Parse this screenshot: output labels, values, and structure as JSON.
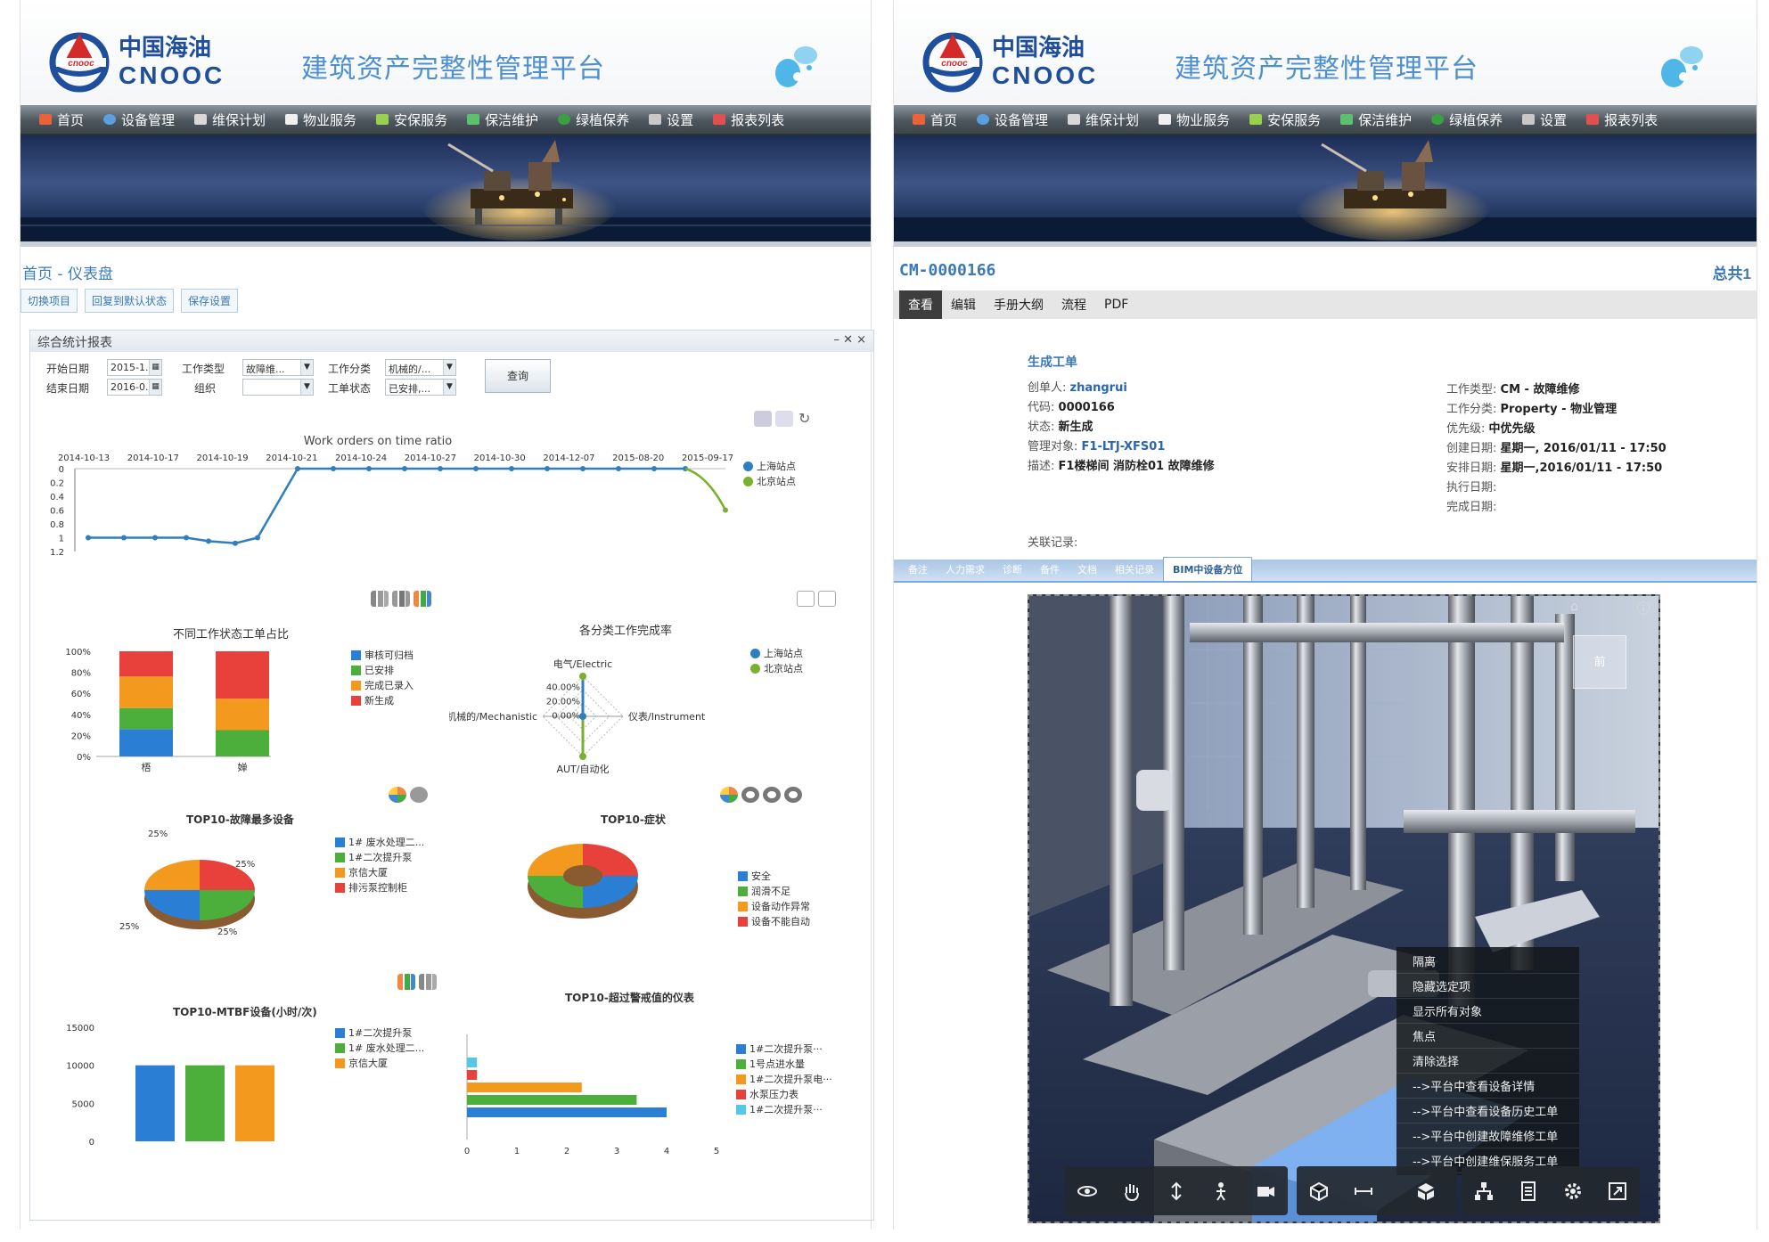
{
  "platform_title": "建筑资产完整性管理平台",
  "brand": {
    "cn": "中国海油",
    "en": "CNOOC",
    "mark": "CNOOC"
  },
  "nav": [
    {
      "label": "首页",
      "icon": "home-icon",
      "color": "#e8633a"
    },
    {
      "label": "设备管理",
      "icon": "equipment-icon",
      "color": "#5aa0e0"
    },
    {
      "label": "维保计划",
      "icon": "plan-icon",
      "color": "#d8d8d8"
    },
    {
      "label": "物业服务",
      "icon": "property-icon",
      "color": "#f0f0f0"
    },
    {
      "label": "安保服务",
      "icon": "security-icon",
      "color": "#9ad050"
    },
    {
      "label": "保洁维护",
      "icon": "clean-icon",
      "color": "#5cc070"
    },
    {
      "label": "绿植保养",
      "icon": "plant-icon",
      "color": "#3aa040"
    },
    {
      "label": "设置",
      "icon": "settings-icon",
      "color": "#c8c8c8"
    },
    {
      "label": "报表列表",
      "icon": "report-icon",
      "color": "#e05050"
    }
  ],
  "left": {
    "breadcrumb": "首页 - 仪表盘",
    "buttons": [
      "切换项目",
      "回复到默认状态",
      "保存设置"
    ],
    "report_title": "综合统计报表",
    "window_controls": "– ✕ ×",
    "filter": {
      "start_label": "开始日期",
      "start_value": "2015-1...",
      "end_label": "结束日期",
      "end_value": "2016-0...",
      "type_label": "工作类型",
      "type_value": "故障维...",
      "org_label": "组织",
      "org_value": "",
      "cat_label": "工作分类",
      "cat_value": "机械的/...",
      "status_label": "工单状态",
      "status_value": "已安排,...",
      "query": "查询"
    },
    "line_chart": {
      "title": "Work orders on time ratio",
      "dates": [
        "2014-10-13",
        "2014-10-17",
        "2014-10-19",
        "2014-10-21",
        "2014-10-24",
        "2014-10-27",
        "2014-10-30",
        "2014-12-07",
        "2015-08-20",
        "2015-09-17"
      ],
      "yticks": [
        "0",
        "0.2",
        "0.4",
        "0.6",
        "0.8",
        "1",
        "1.2"
      ],
      "legend": [
        {
          "name": "上海站点",
          "color": "#2f7fc0"
        },
        {
          "name": "北京站点",
          "color": "#7ab030"
        }
      ]
    },
    "status_chart": {
      "title": "不同工作状态工单占比",
      "yticks": [
        "100%",
        "80%",
        "60%",
        "40%",
        "20%",
        "0%"
      ],
      "cats": [
        "梧",
        "婵"
      ],
      "legend": [
        {
          "name": "审核可归档",
          "color": "#2a7fd4"
        },
        {
          "name": "已安排",
          "color": "#4caf3c"
        },
        {
          "name": "完成已录入",
          "color": "#f39a1e"
        },
        {
          "name": "新生成",
          "color": "#e8403a"
        }
      ]
    },
    "radar_chart": {
      "title": "各分类工作完成率",
      "axes": [
        "电气/Electric",
        "仪表/Instrument",
        "AUT/自动化",
        "机械的/Mechanistic"
      ],
      "ticks": [
        "40.00%",
        "20.00%",
        "0.00%"
      ],
      "legend": [
        {
          "name": "上海站点",
          "color": "#2f7fc0"
        },
        {
          "name": "北京站点",
          "color": "#7ab030"
        }
      ]
    },
    "pie_chart": {
      "title": "TOP10-故障最多设备",
      "labels": [
        "25%",
        "25%",
        "25%",
        "25%"
      ],
      "legend": [
        {
          "name": "1# 废水处理二...",
          "color": "#2a7fd4"
        },
        {
          "name": "1#二次提升泵",
          "color": "#4caf3c"
        },
        {
          "name": "京信大厦",
          "color": "#f39a1e"
        },
        {
          "name": "排污泵控制柜",
          "color": "#e8403a"
        }
      ]
    },
    "donut_chart": {
      "title": "TOP10-症状",
      "legend": [
        {
          "name": "安全",
          "color": "#2a7fd4"
        },
        {
          "name": "润滑不足",
          "color": "#4caf3c"
        },
        {
          "name": "设备动作异常",
          "color": "#f39a1e"
        },
        {
          "name": "设备不能自动",
          "color": "#e8403a"
        }
      ]
    },
    "mtbf_chart": {
      "title": "TOP10-MTBF设备(小时/次)",
      "yticks": [
        "15000",
        "10000",
        "5000",
        "0"
      ],
      "values": [
        10000,
        10000,
        10000
      ],
      "legend": [
        {
          "name": "1#二次提升泵",
          "color": "#2a7fd4"
        },
        {
          "name": "1# 废水处理二...",
          "color": "#4caf3c"
        },
        {
          "name": "京信大厦",
          "color": "#f39a1e"
        }
      ]
    },
    "alarm_chart": {
      "title": "TOP10-超过警戒值的仪表",
      "xticks": [
        "0",
        "1",
        "2",
        "3",
        "4",
        "5"
      ],
      "legend": [
        {
          "name": "1#二次提升泵···",
          "color": "#2a7fd4"
        },
        {
          "name": "1号点进水量",
          "color": "#4caf3c"
        },
        {
          "name": "1#二次提升泵电···",
          "color": "#f39a1e"
        },
        {
          "name": "水泵压力表",
          "color": "#e8403a"
        },
        {
          "name": "1#二次提升泵···",
          "color": "#55c8e8"
        }
      ]
    }
  },
  "right": {
    "code": "CM-0000166",
    "total": "总共1",
    "tabs": [
      "查看",
      "编辑",
      "手册大纲",
      "流程",
      "PDF"
    ],
    "section_title": "生成工单",
    "fields_left": [
      {
        "k": "创单人:",
        "v": "zhangrui",
        "link": true
      },
      {
        "k": "代码:",
        "v": "0000166",
        "link": false
      },
      {
        "k": "状态:",
        "v": "新生成",
        "link": false
      },
      {
        "k": "管理对象:",
        "v": "F1-LTJ-XFS01",
        "link": true
      },
      {
        "k": "描述:",
        "v": "F1楼梯间 消防栓01 故障维修",
        "link": false
      }
    ],
    "fields_right": [
      {
        "k": "工作类型:",
        "v": "CM - 故障维修"
      },
      {
        "k": "工作分类:",
        "v": "Property - 物业管理"
      },
      {
        "k": "优先级:",
        "v": "中优先级"
      },
      {
        "k": "创建日期:",
        "v": "星期一, 2016/01/11 - 17:50"
      },
      {
        "k": "安排日期:",
        "v": "星期一,2016/01/11 - 17:50"
      },
      {
        "k": "执行日期:",
        "v": ""
      },
      {
        "k": "完成日期:",
        "v": ""
      }
    ],
    "related": "关联记录:",
    "subtabs": [
      "备注",
      "人力需求",
      "诊断",
      "备件",
      "文档",
      "相关记录",
      "BIM中设备方位"
    ],
    "view_cube": "前",
    "context_menu": [
      "隔离",
      "隐藏选定项",
      "显示所有对象",
      "焦点",
      "清除选择",
      "-->平台中查看设备详情",
      "-->平台中查看设备历史工单",
      "-->平台中创建故障维修工单",
      "-->平台中创建维保服务工单"
    ]
  }
}
